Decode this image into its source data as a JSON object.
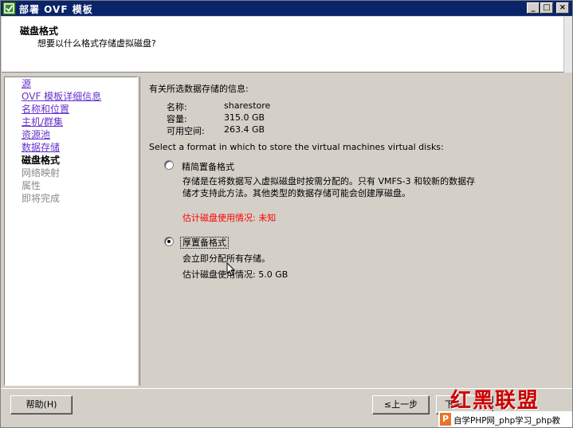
{
  "window": {
    "title": "部署 OVF 模板",
    "controls": {
      "minimize": "_",
      "maximize": "□",
      "close": "×"
    }
  },
  "header": {
    "title": "磁盘格式",
    "subtitle": "想要以什么格式存储虚拟磁盘?"
  },
  "nav": {
    "items": [
      {
        "label": "源",
        "state": "link"
      },
      {
        "label": "OVF 模板详细信息",
        "state": "link"
      },
      {
        "label": "名称和位置",
        "state": "link"
      },
      {
        "label": "主机/群集",
        "state": "link"
      },
      {
        "label": "资源池",
        "state": "link"
      },
      {
        "label": "数据存储",
        "state": "link"
      },
      {
        "label": "磁盘格式",
        "state": "current"
      },
      {
        "label": "网络映射",
        "state": "disabled"
      },
      {
        "label": "属性",
        "state": "disabled"
      },
      {
        "label": "即将完成",
        "state": "disabled"
      }
    ]
  },
  "datastore": {
    "heading": "有关所选数据存储的信息:",
    "name_label": "名称:",
    "name_value": "sharestore",
    "capacity_label": "容量:",
    "capacity_value": "315.0 GB",
    "free_label": "可用空间:",
    "free_value": "263.4 GB"
  },
  "format": {
    "instruction": "Select a format in which to store the virtual machines virtual disks:",
    "thin": {
      "label": "精简置备格式",
      "desc_line1": "存储是在将数据写入虚拟磁盘时按需分配的。只有 VMFS-3 和较新的数据存",
      "desc_line2": "储才支持此方法。其他类型的数据存储可能会创建厚磁盘。",
      "usage": "估计磁盘使用情况: 未知",
      "selected": false
    },
    "thick": {
      "label": "厚置备格式",
      "desc": "会立即分配所有存储。",
      "usage": "估计磁盘使用情况: 5.0 GB",
      "selected": true
    }
  },
  "buttons": {
    "help": "帮助(H)",
    "back": "≤上一步",
    "next": "下一"
  },
  "watermark": {
    "logo": "红黑联盟",
    "bar_icon": "P",
    "bar_text": "自学PHP网_php学习_php教"
  },
  "colors": {
    "title_bar": "#0a246a",
    "link": "#6633cc",
    "warning": "#ff0000",
    "window_bg": "#d4d0c8"
  }
}
